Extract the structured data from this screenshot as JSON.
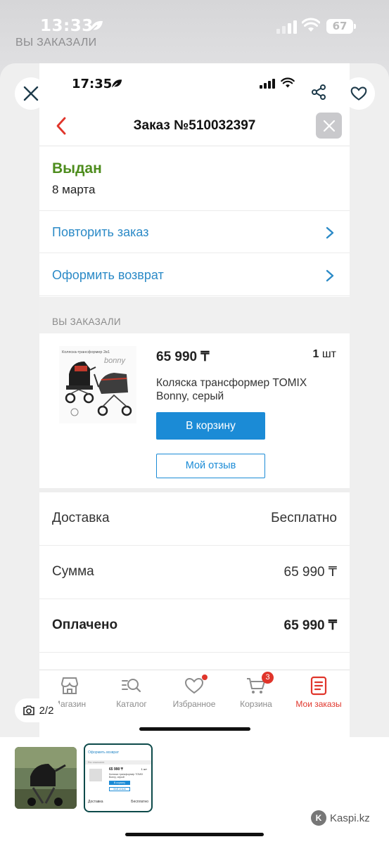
{
  "outer": {
    "time": "13:33",
    "battery": "67",
    "ghost_header": "ВЫ ЗАКАЗАЛИ",
    "counter": "2/2"
  },
  "inner": {
    "time": "17:35",
    "header": {
      "title": "Заказ №510032397"
    },
    "status": {
      "label": "Выдан",
      "date": "8 марта"
    },
    "actions": [
      {
        "label": "Повторить заказ"
      },
      {
        "label": "Оформить возврат"
      }
    ],
    "section_title": "ВЫ ЗАКАЗАЛИ",
    "product": {
      "price": "65 990 ₸",
      "qty_num": "1",
      "qty_unit": "шт",
      "name": "Коляска трансформер TOMIX Bonny, серый",
      "cart_button": "В корзину",
      "review_button": "Мой отзыв",
      "image_caption": "Коляска-трансформер 2в1",
      "image_brand": "bonny"
    },
    "summary": [
      {
        "label": "Доставка",
        "value": "Бесплатно"
      },
      {
        "label": "Сумма",
        "value": "65 990 ₸"
      },
      {
        "label": "Оплачено",
        "value": "65 990 ₸"
      }
    ],
    "tabs": [
      {
        "label": "Магазин"
      },
      {
        "label": "Каталог"
      },
      {
        "label": "Избранное"
      },
      {
        "label": "Корзина",
        "badge": "3"
      },
      {
        "label": "Мои заказы"
      }
    ]
  },
  "thumbnail": {
    "mini_action": "Оформить возврат",
    "mini_section": "Вы заказали",
    "mini_price": "65 990 ₸",
    "mini_qty": "1 шт",
    "mini_name": "Коляска трансформер TOMIX Bonny, серый",
    "mini_cart": "В корзину",
    "mini_review": "Мой отзыв",
    "mini_delivery": "Доставка",
    "mini_delivery_value": "Бесплатно"
  },
  "watermark": "Kaspi.kz",
  "colors": {
    "accent_blue": "#1b8bd6",
    "link_blue": "#2b8ac7",
    "status_green": "#4d8c1d",
    "kaspi_red": "#e0352b"
  },
  "icons": [
    "close-icon",
    "share-icon",
    "heart-icon",
    "back-chevron-icon",
    "chevron-right-icon",
    "shop-icon",
    "catalog-search-icon",
    "favorites-heart-icon",
    "cart-icon",
    "orders-list-icon",
    "camera-icon"
  ]
}
